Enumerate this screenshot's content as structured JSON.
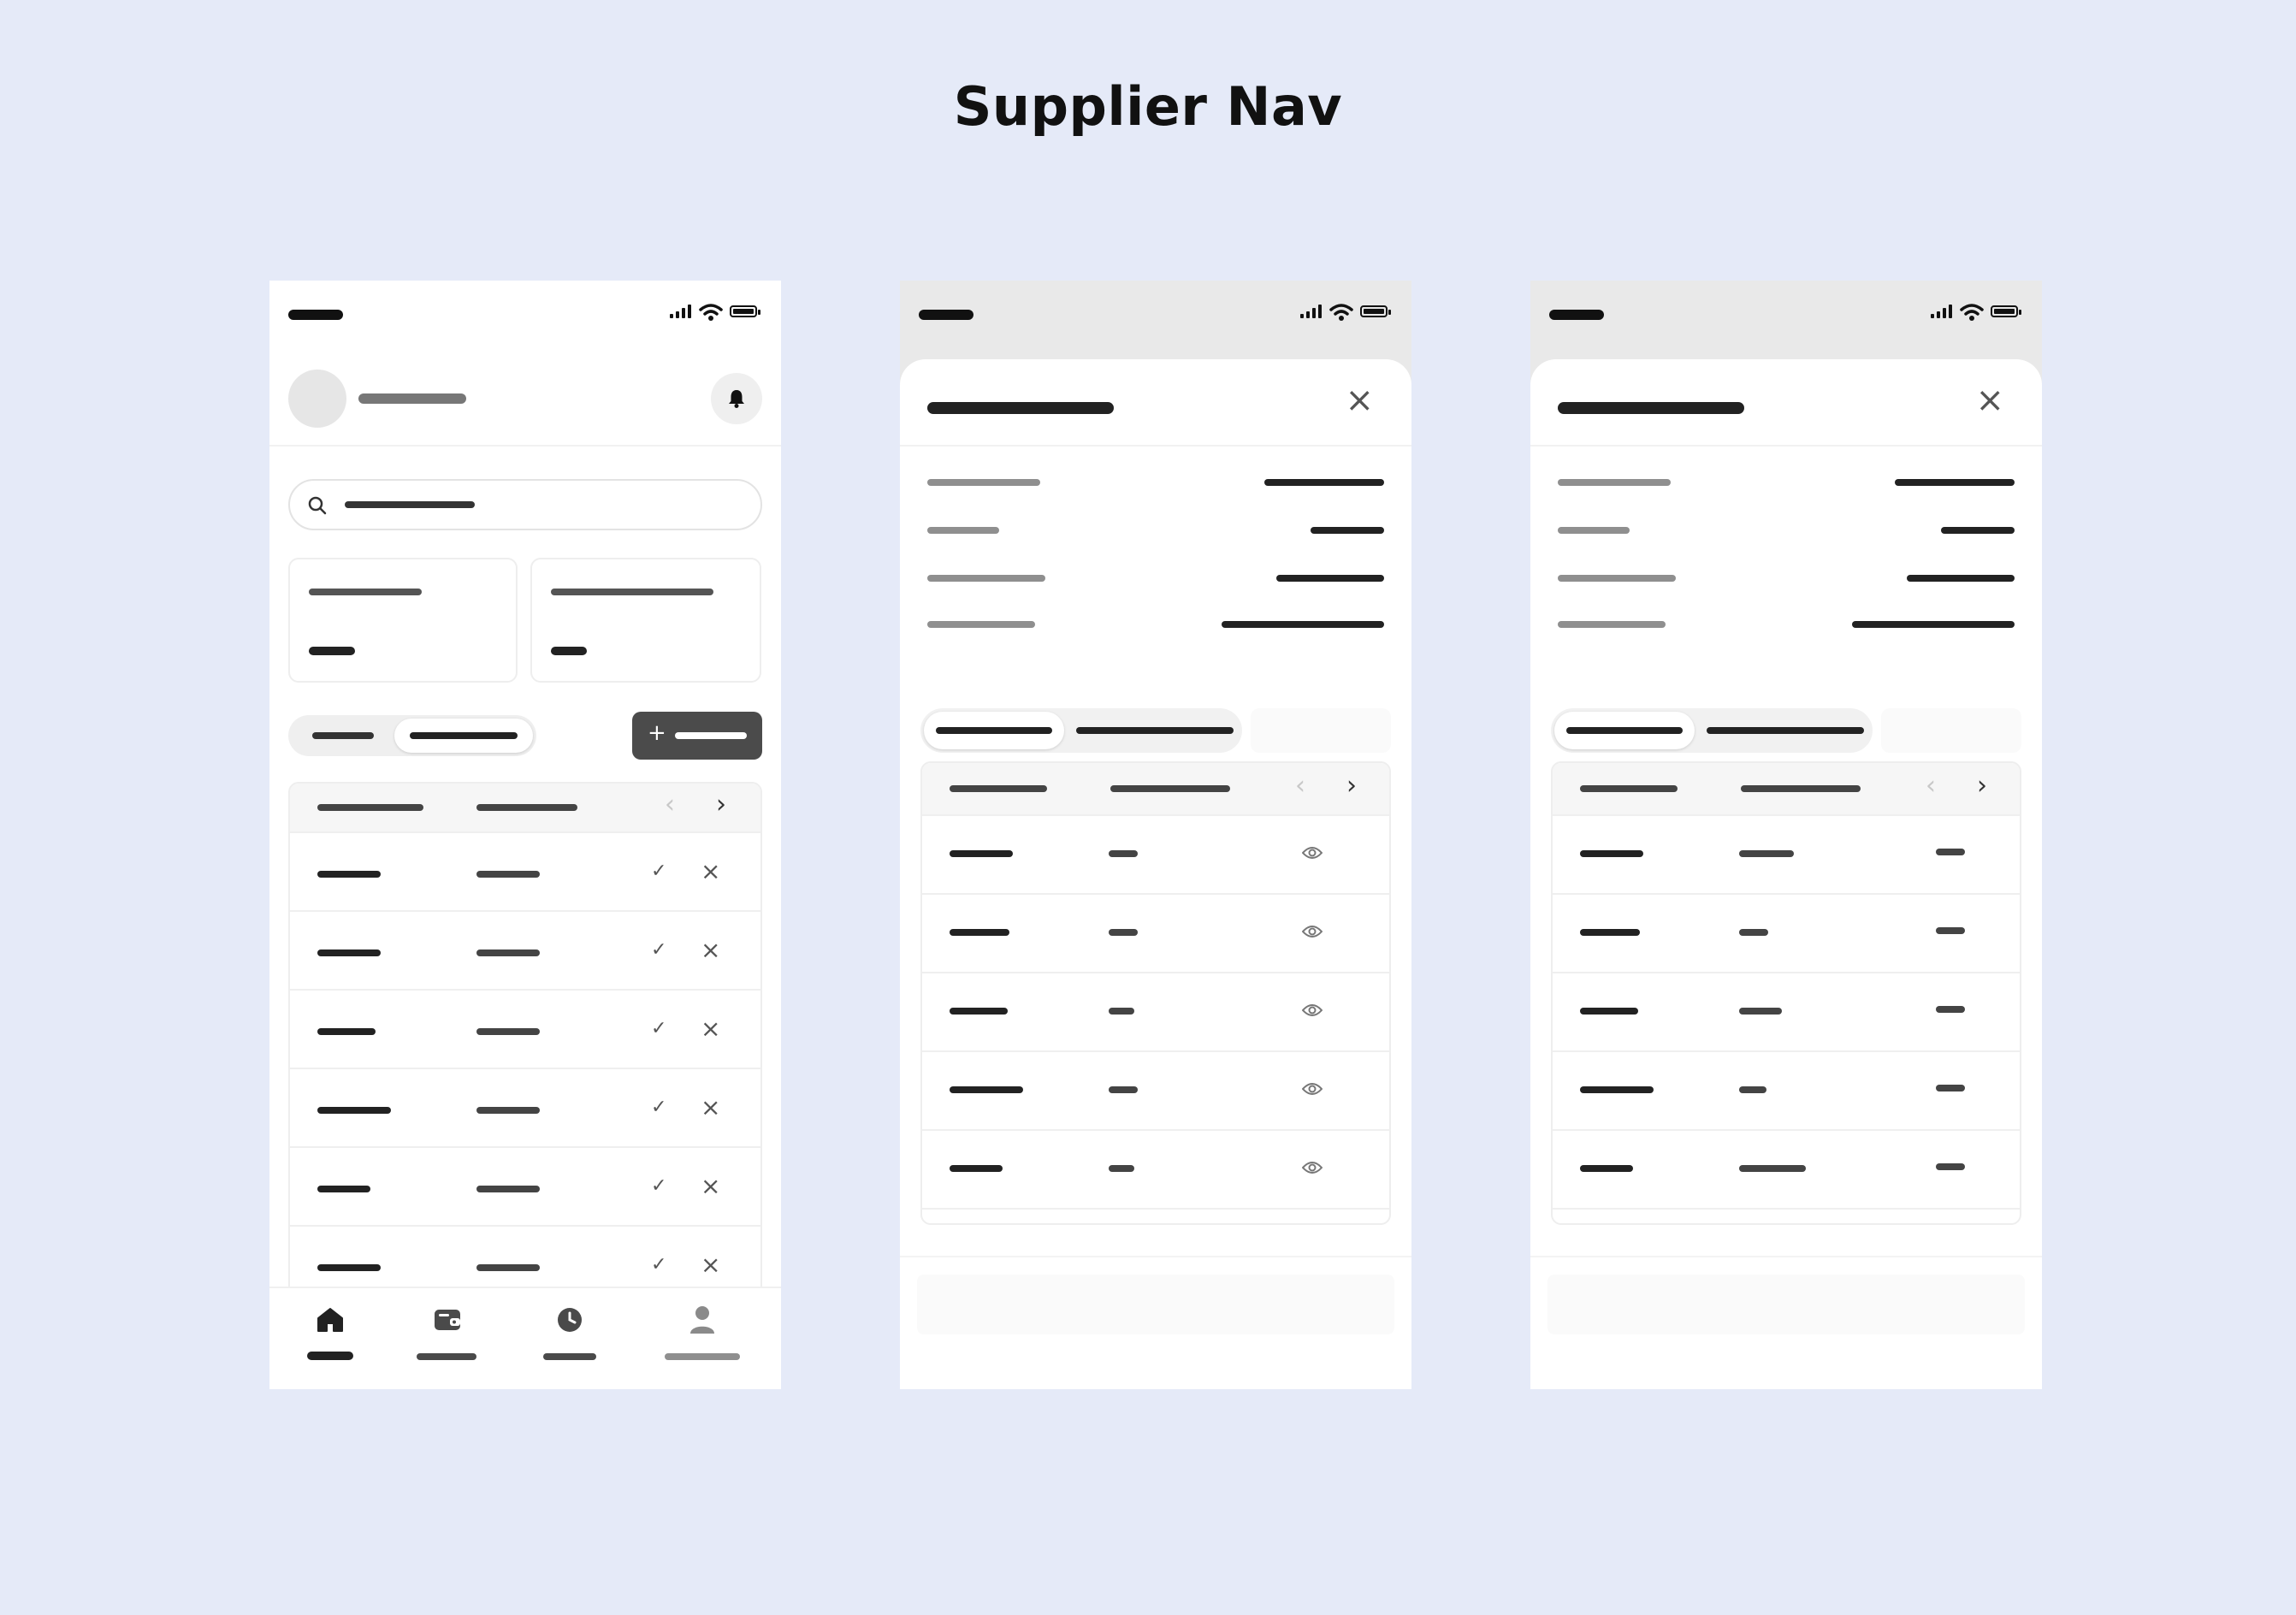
{
  "title": "Supplier Nav",
  "colors": {
    "background": "#e5eaf8",
    "phone": "#ffffff",
    "skeleton_dark": "#222222",
    "skeleton_gray": "#8f8f8f",
    "primary_button": "#4b4b4b"
  },
  "icons": {
    "search": "search-icon",
    "bell": "bell-icon",
    "add": "plus-icon",
    "approve": "check-icon",
    "reject": "close-icon",
    "view": "eye-icon",
    "prev": "chevron-left-icon",
    "next": "chevron-right-icon",
    "nav": [
      "home-icon",
      "wallet-icon",
      "clock-icon",
      "user-icon"
    ]
  },
  "glyphs": {
    "check": "✓",
    "close": "×",
    "chevron_left": "‹",
    "chevron_right": "›",
    "plus": "+"
  },
  "phones": [
    {
      "id": "supplier-home",
      "rows": 6
    },
    {
      "id": "supplier-detail-sheet-view",
      "rows": 6
    },
    {
      "id": "supplier-detail-sheet-status",
      "rows": 6
    }
  ]
}
